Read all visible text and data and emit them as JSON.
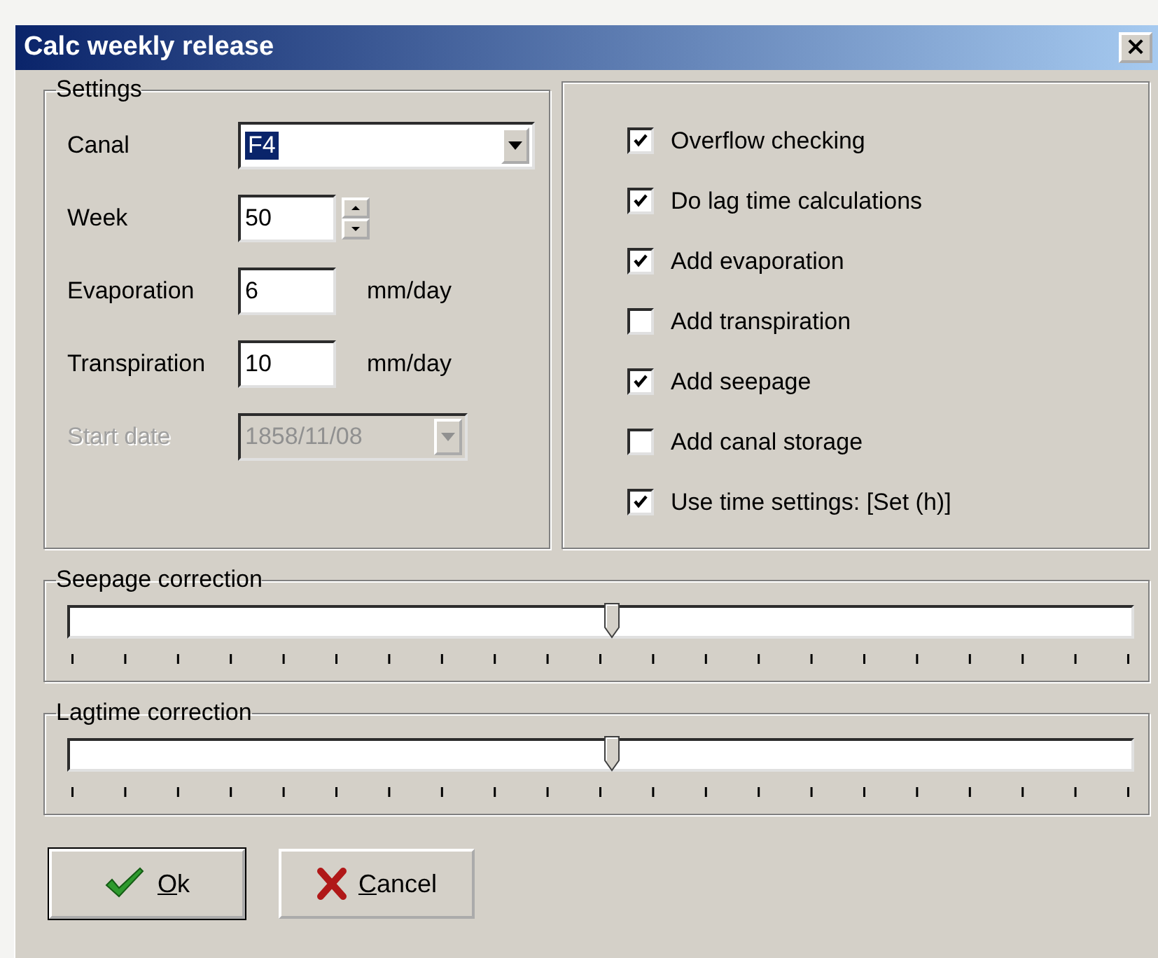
{
  "window": {
    "title": "Calc weekly release",
    "close": "×"
  },
  "settings": {
    "title": "Settings",
    "fields": [
      {
        "kind": "combo",
        "label": "Canal",
        "value": "F4",
        "highlighted": true,
        "disabled": false
      },
      {
        "kind": "spin",
        "label": "Week",
        "value": "50",
        "disabled": false
      },
      {
        "kind": "text",
        "label": "Evaporation",
        "value": "6",
        "unit": "mm/day",
        "disabled": false
      },
      {
        "kind": "text",
        "label": "Transpiration",
        "value": "10",
        "unit": "mm/day",
        "disabled": false
      },
      {
        "kind": "date",
        "label": "Start date",
        "value": "1858/11/08",
        "disabled": true
      }
    ]
  },
  "options": [
    {
      "label": "Overflow checking",
      "checked": true
    },
    {
      "label": "Do lag time calculations",
      "checked": true
    },
    {
      "label": "Add evaporation",
      "checked": true
    },
    {
      "label": "Add transpiration",
      "checked": false
    },
    {
      "label": "Add seepage",
      "checked": true
    },
    {
      "label": "Add canal storage",
      "checked": false
    },
    {
      "label": "Use time settings: [Set (h)]",
      "checked": true
    }
  ],
  "sliders": [
    {
      "title": "Seepage correction",
      "level": 0.51
    },
    {
      "title": "Lagtime correction",
      "level": 0.51
    }
  ],
  "buttons": [
    {
      "kind": "ok",
      "label": "Ok",
      "default": true
    },
    {
      "kind": "cancel",
      "label": "Cancel",
      "default": false
    }
  ]
}
